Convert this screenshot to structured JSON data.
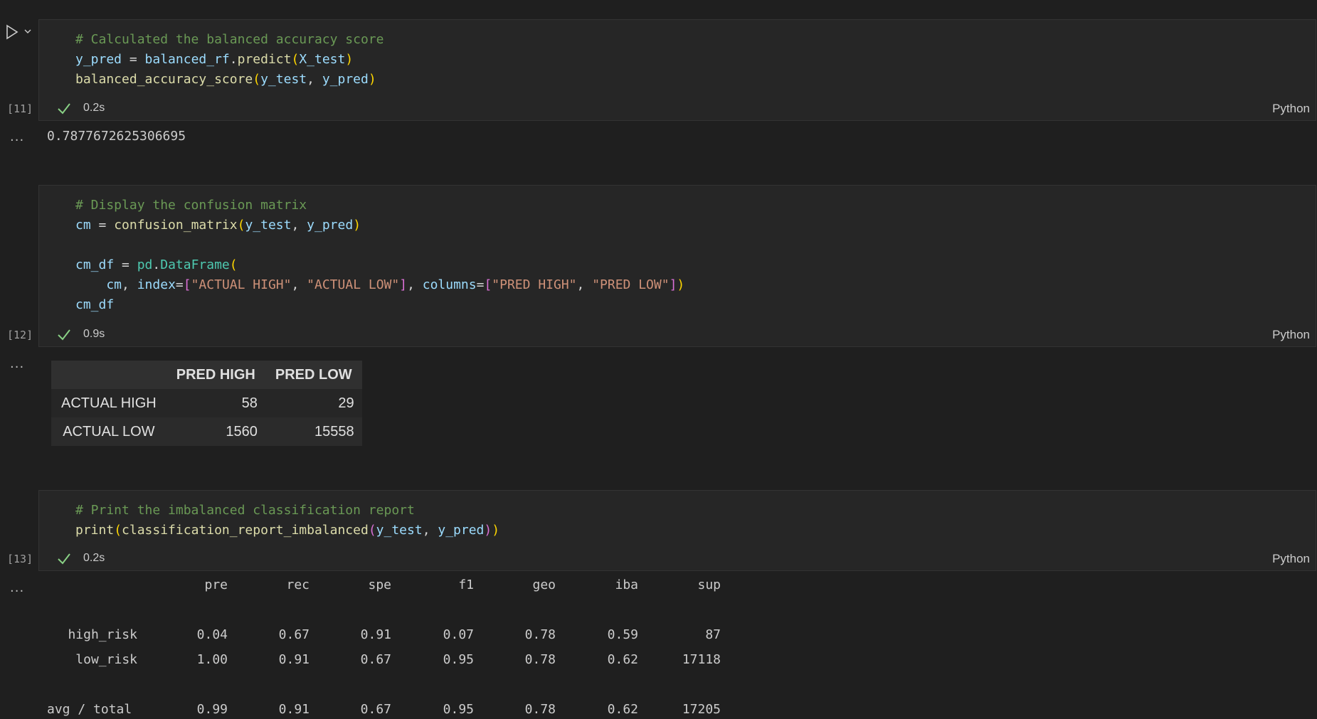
{
  "cells": [
    {
      "exec_label": "[11]",
      "duration": "0.2s",
      "language": "Python",
      "lines": [
        [
          {
            "t": "# Calculated the balanced accuracy score",
            "c": "cmt"
          }
        ],
        [
          {
            "t": "y_pred",
            "c": "var"
          },
          {
            "t": " = ",
            "c": "op"
          },
          {
            "t": "balanced_rf",
            "c": "var"
          },
          {
            "t": ".",
            "c": "op"
          },
          {
            "t": "predict",
            "c": "fn"
          },
          {
            "t": "(",
            "c": "p1"
          },
          {
            "t": "X_test",
            "c": "var"
          },
          {
            "t": ")",
            "c": "p1"
          }
        ],
        [
          {
            "t": "balanced_accuracy_score",
            "c": "fn"
          },
          {
            "t": "(",
            "c": "p1"
          },
          {
            "t": "y_test",
            "c": "var"
          },
          {
            "t": ", ",
            "c": "op"
          },
          {
            "t": "y_pred",
            "c": "var"
          },
          {
            "t": ")",
            "c": "p1"
          }
        ]
      ],
      "output": "0.7877672625306695"
    },
    {
      "exec_label": "[12]",
      "duration": "0.9s",
      "language": "Python",
      "lines": [
        [
          {
            "t": "# Display the confusion matrix",
            "c": "cmt"
          }
        ],
        [
          {
            "t": "cm",
            "c": "var"
          },
          {
            "t": " = ",
            "c": "op"
          },
          {
            "t": "confusion_matrix",
            "c": "fn"
          },
          {
            "t": "(",
            "c": "p1"
          },
          {
            "t": "y_test",
            "c": "var"
          },
          {
            "t": ", ",
            "c": "op"
          },
          {
            "t": "y_pred",
            "c": "var"
          },
          {
            "t": ")",
            "c": "p1"
          }
        ],
        [],
        [
          {
            "t": "cm_df",
            "c": "var"
          },
          {
            "t": " = ",
            "c": "op"
          },
          {
            "t": "pd",
            "c": "cls"
          },
          {
            "t": ".",
            "c": "op"
          },
          {
            "t": "DataFrame",
            "c": "cls"
          },
          {
            "t": "(",
            "c": "p1"
          }
        ],
        [
          {
            "t": "    cm",
            "c": "var"
          },
          {
            "t": ", ",
            "c": "op"
          },
          {
            "t": "index",
            "c": "var"
          },
          {
            "t": "=",
            "c": "op"
          },
          {
            "t": "[",
            "c": "p2"
          },
          {
            "t": "\"ACTUAL HIGH\"",
            "c": "str"
          },
          {
            "t": ", ",
            "c": "op"
          },
          {
            "t": "\"ACTUAL LOW\"",
            "c": "str"
          },
          {
            "t": "]",
            "c": "p2"
          },
          {
            "t": ", ",
            "c": "op"
          },
          {
            "t": "columns",
            "c": "var"
          },
          {
            "t": "=",
            "c": "op"
          },
          {
            "t": "[",
            "c": "p2"
          },
          {
            "t": "\"PRED HIGH\"",
            "c": "str"
          },
          {
            "t": ", ",
            "c": "op"
          },
          {
            "t": "\"PRED LOW\"",
            "c": "str"
          },
          {
            "t": "]",
            "c": "p2"
          },
          {
            "t": ")",
            "c": "p1"
          }
        ],
        [
          {
            "t": "cm_df",
            "c": "var"
          }
        ]
      ],
      "table": {
        "columns": [
          "PRED HIGH",
          "PRED LOW"
        ],
        "rows": [
          {
            "index": "ACTUAL HIGH",
            "values": [
              "58",
              "29"
            ]
          },
          {
            "index": "ACTUAL LOW",
            "values": [
              "1560",
              "15558"
            ]
          }
        ]
      }
    },
    {
      "exec_label": "[13]",
      "duration": "0.2s",
      "language": "Python",
      "lines": [
        [
          {
            "t": "# Print the imbalanced classification report",
            "c": "cmt"
          }
        ],
        [
          {
            "t": "print",
            "c": "fn"
          },
          {
            "t": "(",
            "c": "p1"
          },
          {
            "t": "classification_report_imbalanced",
            "c": "fn"
          },
          {
            "t": "(",
            "c": "p2"
          },
          {
            "t": "y_test",
            "c": "var"
          },
          {
            "t": ", ",
            "c": "op"
          },
          {
            "t": "y_pred",
            "c": "var"
          },
          {
            "t": ")",
            "c": "p2"
          },
          {
            "t": ")",
            "c": "p1"
          }
        ]
      ],
      "report": {
        "headers": [
          "pre",
          "rec",
          "spe",
          "f1",
          "geo",
          "iba",
          "sup"
        ],
        "rows": [
          {
            "label": "high_risk",
            "values": [
              "0.04",
              "0.67",
              "0.91",
              "0.07",
              "0.78",
              "0.59",
              "87"
            ]
          },
          {
            "label": "low_risk",
            "values": [
              "1.00",
              "0.91",
              "0.67",
              "0.95",
              "0.78",
              "0.62",
              "17118"
            ]
          },
          {
            "label": "avg / total",
            "values": [
              "0.99",
              "0.91",
              "0.67",
              "0.95",
              "0.78",
              "0.62",
              "17205"
            ]
          }
        ]
      }
    }
  ],
  "output_marker": "...",
  "colors": {
    "background": "#1f1f1f",
    "cell_bg": "#262626",
    "check_green": "#89d185"
  }
}
